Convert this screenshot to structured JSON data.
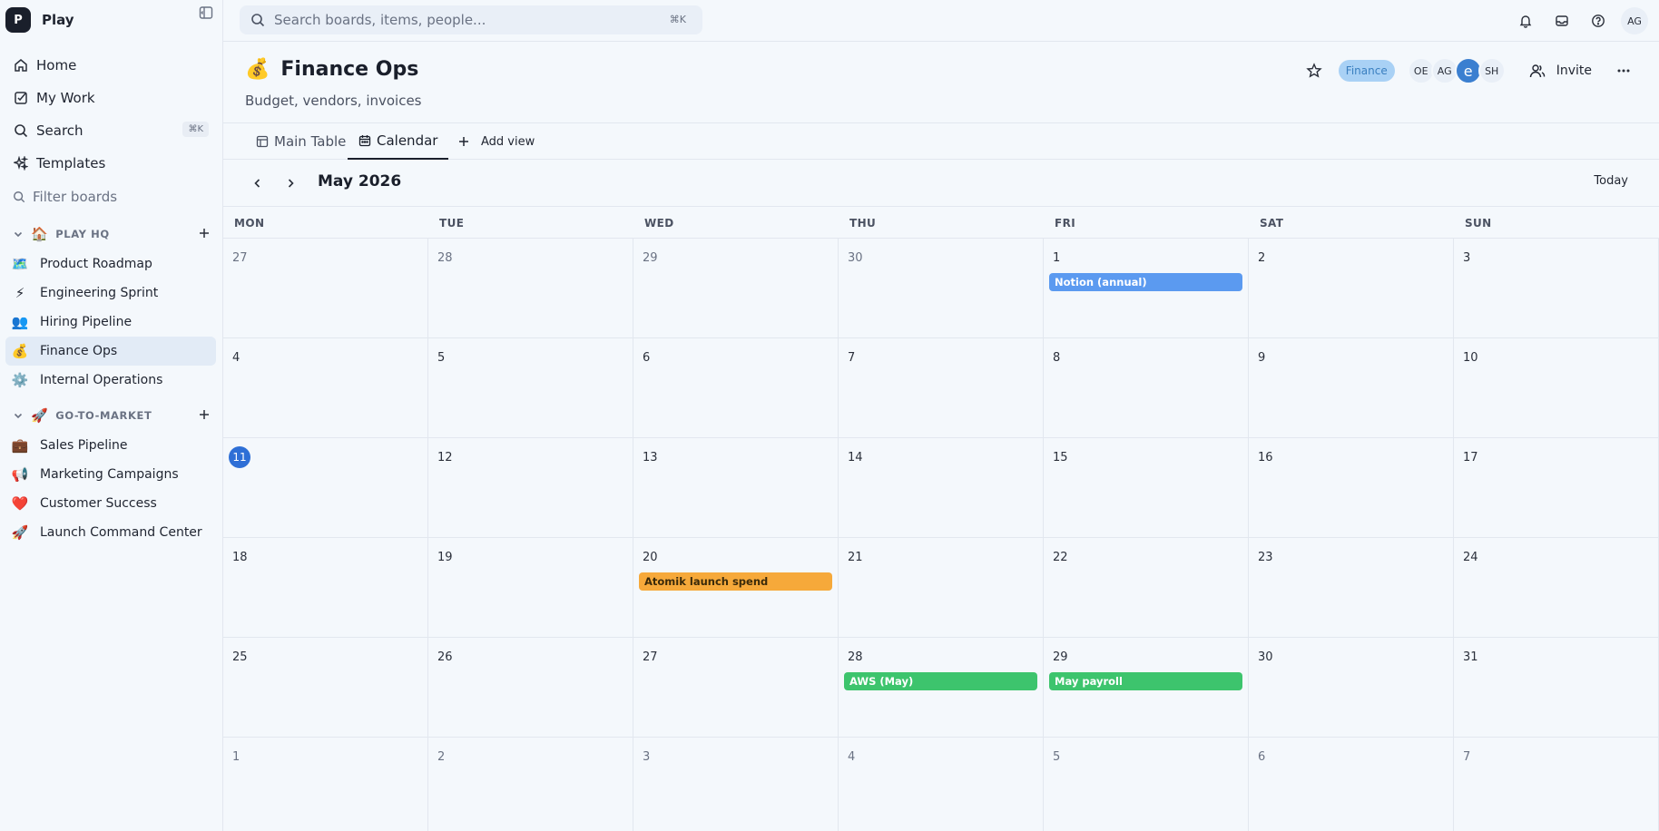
{
  "workspace": {
    "logo": "P",
    "name": "Play"
  },
  "nav": [
    {
      "label": "Home",
      "icon": "home-icon"
    },
    {
      "label": "My Work",
      "icon": "check-square-icon"
    },
    {
      "label": "Search",
      "icon": "search-icon",
      "kbd": "⌘K"
    },
    {
      "label": "Templates",
      "icon": "sparkles-icon"
    }
  ],
  "filter": {
    "placeholder": "Filter boards"
  },
  "sections": [
    {
      "emoji": "🏠",
      "title": "PLAY HQ",
      "boards": [
        {
          "emoji": "🗺️",
          "label": "Product Roadmap"
        },
        {
          "emoji": "⚡",
          "label": "Engineering Sprint"
        },
        {
          "emoji": "👥",
          "label": "Hiring Pipeline"
        },
        {
          "emoji": "💰",
          "label": "Finance Ops"
        },
        {
          "emoji": "⚙️",
          "label": "Internal Operations"
        }
      ]
    },
    {
      "emoji": "🚀",
      "title": "GO-TO-MARKET",
      "boards": [
        {
          "emoji": "💼",
          "label": "Sales Pipeline"
        },
        {
          "emoji": "📢",
          "label": "Marketing Campaigns"
        },
        {
          "emoji": "❤️",
          "label": "Customer Success"
        },
        {
          "emoji": "🚀",
          "label": "Launch Command Center"
        }
      ]
    }
  ],
  "topbar": {
    "search_placeholder": "Search boards, items, people...",
    "search_kbd": "⌘K",
    "user_initials": "AG"
  },
  "board": {
    "emoji": "💰",
    "title": "Finance Ops",
    "description": "Budget, vendors, invoices",
    "tag": "Finance",
    "members": [
      "OE",
      "AG",
      "e",
      "SH"
    ],
    "invite_label": "Invite"
  },
  "tabs": {
    "main_table": "Main Table",
    "calendar": "Calendar",
    "add_view": "Add view"
  },
  "calendar": {
    "month_label": "May 2026",
    "today_label": "Today",
    "weekdays": [
      "MON",
      "TUE",
      "WED",
      "THU",
      "FRI",
      "SAT",
      "SUN"
    ],
    "weeks": [
      [
        27,
        28,
        29,
        30,
        1,
        2,
        3
      ],
      [
        4,
        5,
        6,
        7,
        8,
        9,
        10
      ],
      [
        11,
        12,
        13,
        14,
        15,
        16,
        17
      ],
      [
        18,
        19,
        20,
        21,
        22,
        23,
        24
      ],
      [
        25,
        26,
        27,
        28,
        29,
        30,
        31
      ],
      [
        1,
        2,
        3,
        4,
        5,
        6,
        7
      ]
    ],
    "today": {
      "week": 2,
      "day": 0
    },
    "events": [
      {
        "week": 0,
        "day": 4,
        "label": "Notion (annual)",
        "color": "#5b9af0"
      },
      {
        "week": 3,
        "day": 2,
        "label": "Atomik launch spend",
        "color": "#f6a93a"
      },
      {
        "week": 4,
        "day": 3,
        "label": "AWS (May)",
        "color": "#3dc46d"
      },
      {
        "week": 4,
        "day": 4,
        "label": "May payroll",
        "color": "#3dc46d"
      }
    ]
  }
}
